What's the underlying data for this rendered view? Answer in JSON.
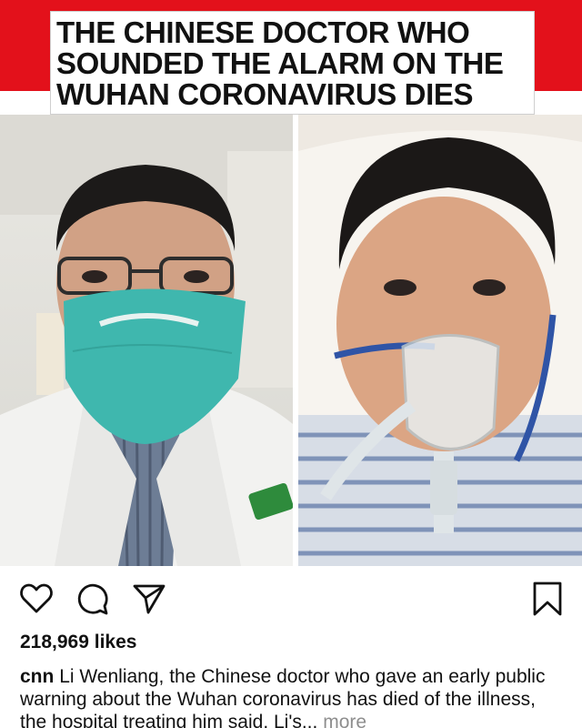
{
  "post": {
    "headline_lines": [
      "THE CHINESE DOCTOR WHO",
      "SOUNDED THE ALARM ON THE",
      "WUHAN CORONAVIRUS DIES"
    ],
    "likes": "218,969 likes",
    "caption": {
      "username": "cnn",
      "text": "Li Wenliang, the Chinese doctor who gave an early public warning about the Wuhan coronavirus has died of the illness, the hospital treating him said. Li's...",
      "more": "more"
    }
  },
  "icons": {
    "like": "heart-icon",
    "comment": "comment-icon",
    "share": "paper-plane-icon",
    "save": "bookmark-icon"
  },
  "colors": {
    "banner_red": "#e3111b",
    "mask_teal": "#3fb7ae",
    "more_gray": "#8e8e8e"
  }
}
